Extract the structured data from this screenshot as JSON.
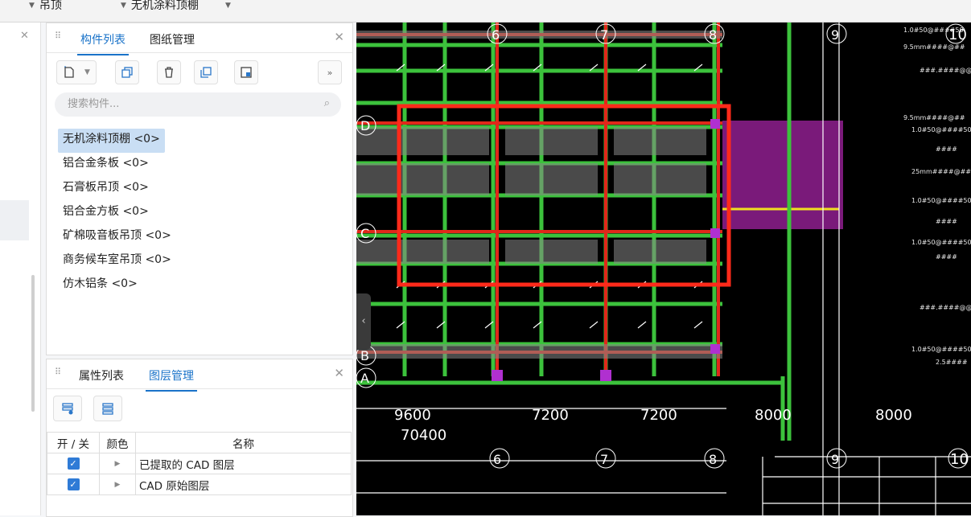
{
  "topbar": {
    "dropdown1": "吊顶",
    "dropdown2": "无机涂料顶棚",
    "dropdown3": ""
  },
  "component_panel": {
    "tabs": [
      "构件列表",
      "图纸管理"
    ],
    "active_tab": "构件列表",
    "toolbar_icons": [
      "new-component-icon",
      "copy-icon",
      "delete-icon",
      "layer-copy-icon",
      "save-icon",
      "more-icon"
    ],
    "search": {
      "placeholder": "搜索构件..."
    },
    "items": [
      {
        "label": "无机涂料顶棚 <0>",
        "selected": true
      },
      {
        "label": "铝合金条板 <0>",
        "selected": false
      },
      {
        "label": "石膏板吊顶 <0>",
        "selected": false
      },
      {
        "label": "铝合金方板 <0>",
        "selected": false
      },
      {
        "label": "矿棉吸音板吊顶 <0>",
        "selected": false
      },
      {
        "label": "商务候车室吊顶 <0>",
        "selected": false
      },
      {
        "label": "仿木铝条 <0>",
        "selected": false
      }
    ]
  },
  "layer_panel": {
    "tabs": [
      "属性列表",
      "图层管理"
    ],
    "active_tab": "图层管理",
    "columns": [
      "开 / 关",
      "颜色",
      "名称"
    ],
    "rows": [
      {
        "checked": true,
        "name": "已提取的 CAD 图层"
      },
      {
        "checked": true,
        "name": "CAD 原始图层"
      }
    ]
  },
  "cad": {
    "grid_numbers_top": [
      "6",
      "7",
      "8",
      "9",
      "10"
    ],
    "grid_numbers_bottom": [
      "6",
      "7",
      "8",
      "9",
      "10"
    ],
    "grid_letters": [
      "D",
      "C",
      "B",
      "A"
    ],
    "dimensions": [
      "9600",
      "7200",
      "7200",
      "8000",
      "8000",
      "70400"
    ],
    "highlight_color": "#ff2a1a"
  }
}
